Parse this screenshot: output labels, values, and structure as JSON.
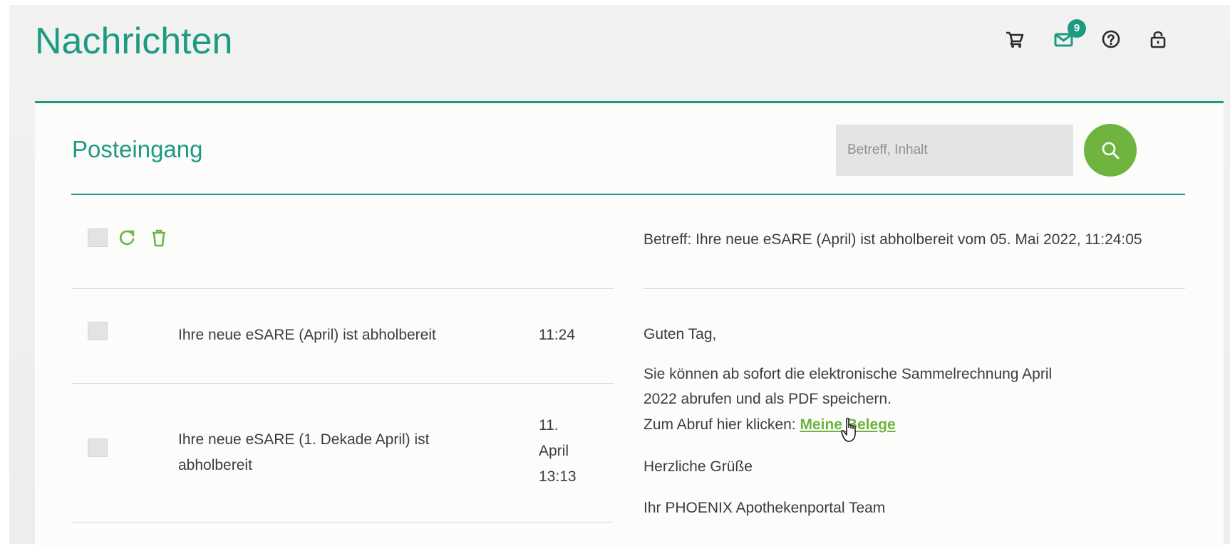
{
  "header": {
    "title": "Nachrichten",
    "icons": [
      "cart-icon",
      "mail-icon",
      "help-icon",
      "lock-icon"
    ],
    "mail_badge_count": "9"
  },
  "inbox": {
    "title": "Posteingang",
    "search": {
      "placeholder": "Betreff, Inhalt",
      "value": ""
    },
    "toolbar": {
      "icons": [
        "select-all-checkbox",
        "refresh-icon",
        "trash-icon"
      ]
    },
    "messages": [
      {
        "subject": "Ihre neue eSARE (April) ist abholbereit",
        "time": "11:24",
        "checked": false
      },
      {
        "subject": "Ihre neue eSARE (1. Dekade April) ist abholbereit",
        "time": "11. April 13:13",
        "checked": false
      }
    ]
  },
  "detail": {
    "subject_line": "Betreff: Ihre neue eSARE (April) ist abholbereit vom 05. Mai 2022, 11:24:05",
    "greeting": "Guten Tag,",
    "body_line_1": "Sie können ab sofort die elektronische Sammelrechnung April",
    "body_line_2": "2022 abrufen und als PDF speichern.",
    "link_prefix": "Zum Abruf hier klicken:",
    "link_text": "Meine Belege",
    "closing": "Herzliche Grüße",
    "signature": "Ihr PHOENIX Apothekenportal Team"
  },
  "colors": {
    "brand_teal": "#1e9a84",
    "accent_green": "#6eb43f",
    "text": "#3c3c3c",
    "search_bg": "#e3e4e3"
  }
}
